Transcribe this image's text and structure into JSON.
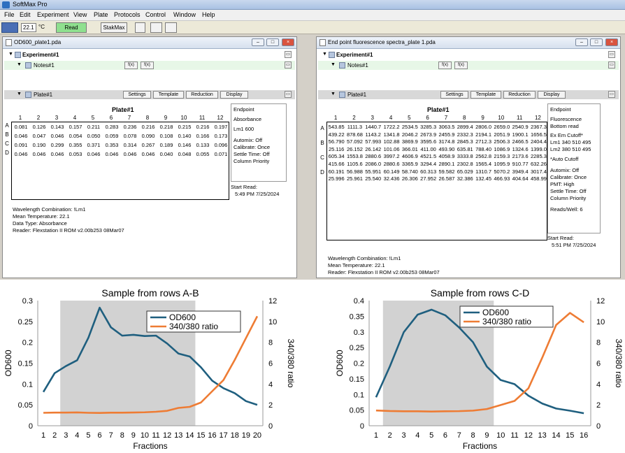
{
  "app": {
    "title": "SoftMax Pro",
    "menus": [
      "File",
      "Edit",
      "Experiment",
      "View",
      "Plate",
      "Protocols",
      "Control",
      "Window",
      "Help"
    ],
    "toolbar": {
      "temperature": "22.1",
      "temp_unit": "°C",
      "read_label": "Read",
      "stakmax_label": "StakMax"
    }
  },
  "left_window": {
    "title": "OD600_plate1.pda",
    "experiment_label": "Experiment#1",
    "notes_label": "Notes#1",
    "plate_label": "Plate#1",
    "plate_buttons": [
      "Settings",
      "Template",
      "Reduction",
      "Display"
    ],
    "plate_title": "Plate#1",
    "columns": [
      "1",
      "2",
      "3",
      "4",
      "5",
      "6",
      "7",
      "8",
      "9",
      "10",
      "11",
      "12"
    ],
    "rows": [
      "A",
      "B",
      "C",
      "D"
    ],
    "values": [
      [
        "0.081",
        "0.126",
        "0.143",
        "0.157",
        "0.211",
        "0.283",
        "0.236",
        "0.216",
        "0.218",
        "0.215",
        "0.216",
        "0.197"
      ],
      [
        "0.046",
        "0.047",
        "0.046",
        "0.054",
        "0.050",
        "0.059",
        "0.078",
        "0.090",
        "0.108",
        "0.140",
        "0.166",
        "0.173"
      ],
      [
        "0.091",
        "0.190",
        "0.299",
        "0.355",
        "0.371",
        "0.353",
        "0.314",
        "0.267",
        "0.189",
        "0.146",
        "0.133",
        "0.096"
      ],
      [
        "0.046",
        "0.046",
        "0.046",
        "0.053",
        "0.046",
        "0.046",
        "0.046",
        "0.046",
        "0.040",
        "0.048",
        "0.055",
        "0.071"
      ]
    ],
    "side": [
      "Endpoint",
      "Absorbance",
      "Lm1  600",
      "Automix: Off",
      "Calibrate: Once",
      "Settle Time: Off",
      "Column Priority"
    ],
    "start_read_label": "Start Read:",
    "start_read_time": "5:49 PM  7/25/2024",
    "info": [
      "Wavelength Combination: !Lm1",
      "Mean Temperature: 22.1",
      "Data Type: Absorbance",
      "Reader: Flexstation II ROM v2.00b253 08Mar07"
    ]
  },
  "right_window": {
    "title": "End point fluorescence spectra_plate 1.pda",
    "experiment_label": "Experiment#1",
    "notes_label": "Notes#1",
    "plate_label": "Plate#1",
    "plate_buttons": [
      "Settings",
      "Template",
      "Reduction",
      "Display"
    ],
    "plate_title": "Plate#1",
    "columns": [
      "1",
      "2",
      "3",
      "4",
      "5",
      "6",
      "7",
      "8",
      "9",
      "10",
      "11",
      "12"
    ],
    "rows": [
      "A",
      "B",
      "C",
      "D"
    ],
    "values": [
      [
        "543.85",
        "1111.3",
        "1440.7",
        "1722.2",
        "2534.5",
        "3285.3",
        "3063.5",
        "2899.4",
        "2806.0",
        "2659.0",
        "2540.9",
        "2367.3"
      ],
      [
        "439.22",
        "878.68",
        "1143.2",
        "1341.8",
        "2046.2",
        "2673.9",
        "2455.9",
        "2332.3",
        "2194.1",
        "2051.9",
        "1900.1",
        "1656.5"
      ],
      [
        "56.790",
        "57.092",
        "57.993",
        "102.88",
        "3869.9",
        "3595.6",
        "3174.8",
        "2845.3",
        "2712.3",
        "2506.3",
        "2466.5",
        "2404.4"
      ],
      [
        "25.116",
        "26.152",
        "26.142",
        "101.06",
        "366.01",
        "411.00",
        "493.90",
        "635.81",
        "788.40",
        "1086.9",
        "1324.6",
        "1399.0"
      ],
      [
        "605.34",
        "1553.8",
        "2880.6",
        "3997.2",
        "4606.9",
        "4521.5",
        "4058.9",
        "3333.8",
        "2562.8",
        "2159.3",
        "2173.6",
        "2285.3"
      ],
      [
        "415.66",
        "1105.6",
        "2086.0",
        "2880.6",
        "3365.9",
        "3294.4",
        "2890.1",
        "2302.8",
        "1565.4",
        "1095.9",
        "910.77",
        "632.26"
      ],
      [
        "60.191",
        "56.988",
        "55.951",
        "60.149",
        "58.740",
        "60.313",
        "59.582",
        "65.029",
        "1310.7",
        "5070.2",
        "3949.4",
        "3017.4"
      ],
      [
        "25.996",
        "25.961",
        "25.540",
        "32.436",
        "26.306",
        "27.952",
        "26.587",
        "32.386",
        "132.45",
        "466.93",
        "404.64",
        "458.99"
      ]
    ],
    "side": [
      "Endpoint",
      "Fluorescence",
      "Bottom read",
      "Ex  Em  Cutoff*",
      "Lm1 340  510   495",
      "Lm2 380  510   495",
      "*Auto Cutoff",
      "Automix: Off",
      "Calibrate: Once",
      "PMT: High",
      "Settle Time: Off",
      "Column Priority",
      "Reads/Well: 6"
    ],
    "start_read_label": "Start Read:",
    "start_read_time": "5:51 PM  7/25/2024",
    "info": [
      "Wavelength Combination: !Lm1",
      "Mean Temperature: 22.1",
      "Reader: Flexstation II ROM v2.00b253 08Mar07"
    ]
  },
  "chart_data": [
    {
      "type": "line",
      "title": "Sample from rows A-B",
      "xlabel": "Fractions",
      "ylabel": "OD600",
      "y2label": "340/380 ratio",
      "x": [
        1,
        2,
        3,
        4,
        5,
        6,
        7,
        8,
        9,
        10,
        11,
        12,
        13,
        14,
        15,
        16,
        17,
        18,
        19,
        20
      ],
      "xlim": [
        0.5,
        20.5
      ],
      "ylim": [
        0,
        0.3
      ],
      "y2lim": [
        0,
        12
      ],
      "yticks": [
        "0",
        "0.05",
        "0.1",
        "0.15",
        "0.2",
        "0.25",
        "0.3"
      ],
      "y2ticks": [
        "0",
        "2",
        "4",
        "6",
        "8",
        "10",
        "12"
      ],
      "shaded_x": [
        2.5,
        14.5
      ],
      "legend": "top-center",
      "series": [
        {
          "name": "OD600",
          "axis": "left",
          "color": "#1f5f7f",
          "values": [
            0.081,
            0.126,
            0.143,
            0.157,
            0.211,
            0.283,
            0.236,
            0.216,
            0.218,
            0.215,
            0.216,
            0.197,
            0.173,
            0.166,
            0.14,
            0.108,
            0.09,
            0.078,
            0.059,
            0.05
          ]
        },
        {
          "name": "340/380 ratio",
          "axis": "right",
          "color": "#ee7c34",
          "values": [
            1.24,
            1.26,
            1.26,
            1.28,
            1.24,
            1.23,
            1.25,
            1.25,
            1.27,
            1.29,
            1.34,
            1.43,
            1.71,
            1.81,
            2.23,
            3.31,
            4.38,
            6.31,
            8.41,
            10.5
          ]
        }
      ]
    },
    {
      "type": "line",
      "title": "Sample from rows C-D",
      "xlabel": "Fractions",
      "ylabel": "OD600",
      "y2label": "340/380 ratio",
      "x": [
        1,
        2,
        3,
        4,
        5,
        6,
        7,
        8,
        9,
        10,
        11,
        12,
        13,
        14,
        15,
        16
      ],
      "xlim": [
        0.5,
        16.5
      ],
      "ylim": [
        0,
        0.4
      ],
      "y2lim": [
        0,
        12
      ],
      "yticks": [
        "0",
        "0.05",
        "0.1",
        "0.15",
        "0.2",
        "0.25",
        "0.3",
        "0.35",
        "0.4"
      ],
      "y2ticks": [
        "0",
        "2",
        "4",
        "6",
        "8",
        "10",
        "12"
      ],
      "shaded_x": [
        1.5,
        9.5
      ],
      "legend": "top-right",
      "series": [
        {
          "name": "OD600",
          "axis": "left",
          "color": "#1f5f7f",
          "values": [
            0.091,
            0.19,
            0.299,
            0.355,
            0.371,
            0.353,
            0.314,
            0.267,
            0.189,
            0.146,
            0.133,
            0.096,
            0.071,
            0.055,
            0.048,
            0.04
          ]
        },
        {
          "name": "340/380 ratio",
          "axis": "right",
          "color": "#ee7c34",
          "values": [
            1.46,
            1.41,
            1.39,
            1.39,
            1.36,
            1.39,
            1.4,
            1.45,
            1.6,
            1.99,
            2.38,
            3.59,
            6.53,
            9.66,
            10.82,
            9.92
          ]
        }
      ]
    }
  ]
}
